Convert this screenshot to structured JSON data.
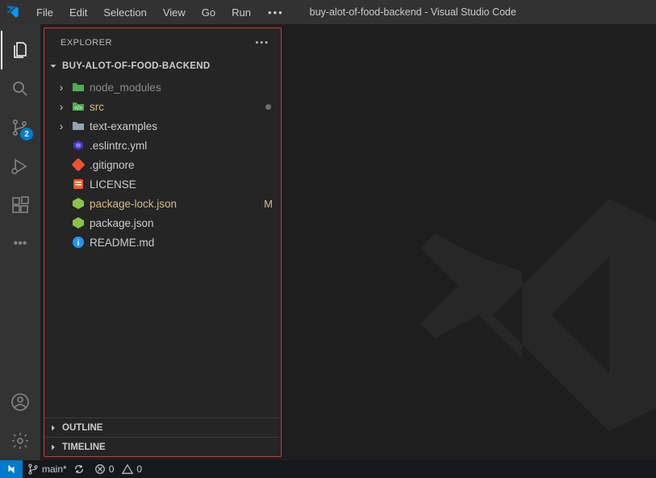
{
  "titlebar": {
    "menus": [
      "File",
      "Edit",
      "Selection",
      "View",
      "Go",
      "Run"
    ],
    "title": "buy-alot-of-food-backend - Visual Studio Code"
  },
  "activitybar": {
    "scm_badge": "2"
  },
  "explorer": {
    "header": "EXPLORER",
    "project": "BUY-ALOT-OF-FOOD-BACKEND",
    "items": [
      {
        "name": "node_modules",
        "type": "folder",
        "dimmed": true,
        "chevron": ">"
      },
      {
        "name": "src",
        "type": "folder-src",
        "modified_dot": true,
        "chevron": ">"
      },
      {
        "name": "text-examples",
        "type": "folder",
        "chevron": ">"
      },
      {
        "name": ".eslintrc.yml",
        "type": "eslint",
        "chevron": ""
      },
      {
        "name": ".gitignore",
        "type": "git",
        "chevron": ""
      },
      {
        "name": "LICENSE",
        "type": "license",
        "chevron": ""
      },
      {
        "name": "package-lock.json",
        "type": "nodejs",
        "modified_letter": "M",
        "modified": true,
        "chevron": ""
      },
      {
        "name": "package.json",
        "type": "nodejs",
        "chevron": ""
      },
      {
        "name": "README.md",
        "type": "info",
        "chevron": ""
      }
    ],
    "sections": [
      "OUTLINE",
      "TIMELINE"
    ]
  },
  "statusbar": {
    "branch": "main*",
    "errors": "0",
    "warnings": "0"
  }
}
